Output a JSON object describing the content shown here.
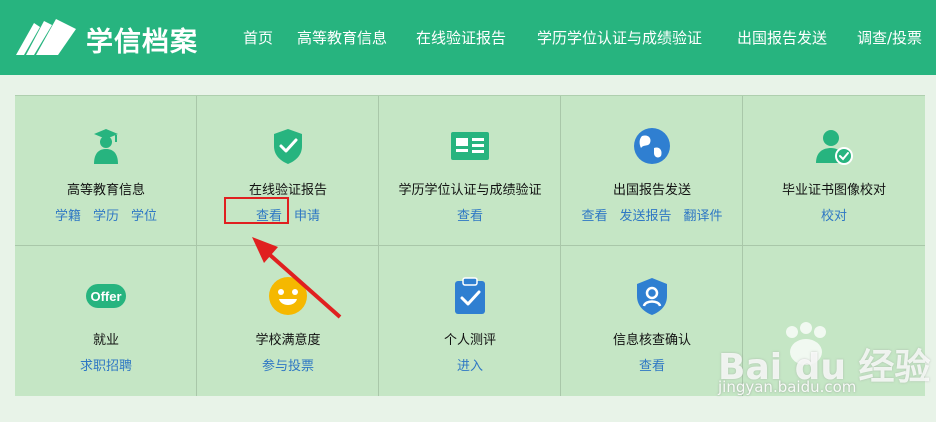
{
  "header": {
    "brand": "学信档案",
    "nav": [
      "首页",
      "高等教育信息",
      "在线验证报告",
      "学历学位认证与成绩验证",
      "出国报告发送",
      "调查/投票"
    ]
  },
  "services": [
    {
      "icon": "graduate-icon",
      "title": "高等教育信息",
      "links": [
        "学籍",
        "学历",
        "学位"
      ]
    },
    {
      "icon": "shield-check-icon",
      "title": "在线验证报告",
      "links": [
        "查看",
        "申请"
      ]
    },
    {
      "icon": "certificate-card-icon",
      "title": "学历学位认证与成绩验证",
      "links": [
        "查看"
      ]
    },
    {
      "icon": "globe-icon",
      "title": "出国报告发送",
      "links": [
        "查看",
        "发送报告",
        "翻译件"
      ]
    },
    {
      "icon": "user-check-icon",
      "title": "毕业证书图像校对",
      "links": [
        "校对"
      ]
    },
    {
      "icon": "offer-badge-icon",
      "icon_text": "Offer",
      "title": "就业",
      "links": [
        "求职招聘"
      ]
    },
    {
      "icon": "smiley-icon",
      "title": "学校满意度",
      "links": [
        "参与投票"
      ]
    },
    {
      "icon": "clipboard-check-icon",
      "title": "个人测评",
      "links": [
        "进入"
      ]
    },
    {
      "icon": "shield-user-icon",
      "title": "信息核查确认",
      "links": [
        "查看"
      ]
    }
  ],
  "watermark": {
    "text": "Bai du 经验",
    "url": "jingyan.baidu.com"
  },
  "colors": {
    "header": "#27b47f",
    "panel": "#c5e6c5",
    "link": "#2f78c4",
    "annotation": "#e02020"
  }
}
